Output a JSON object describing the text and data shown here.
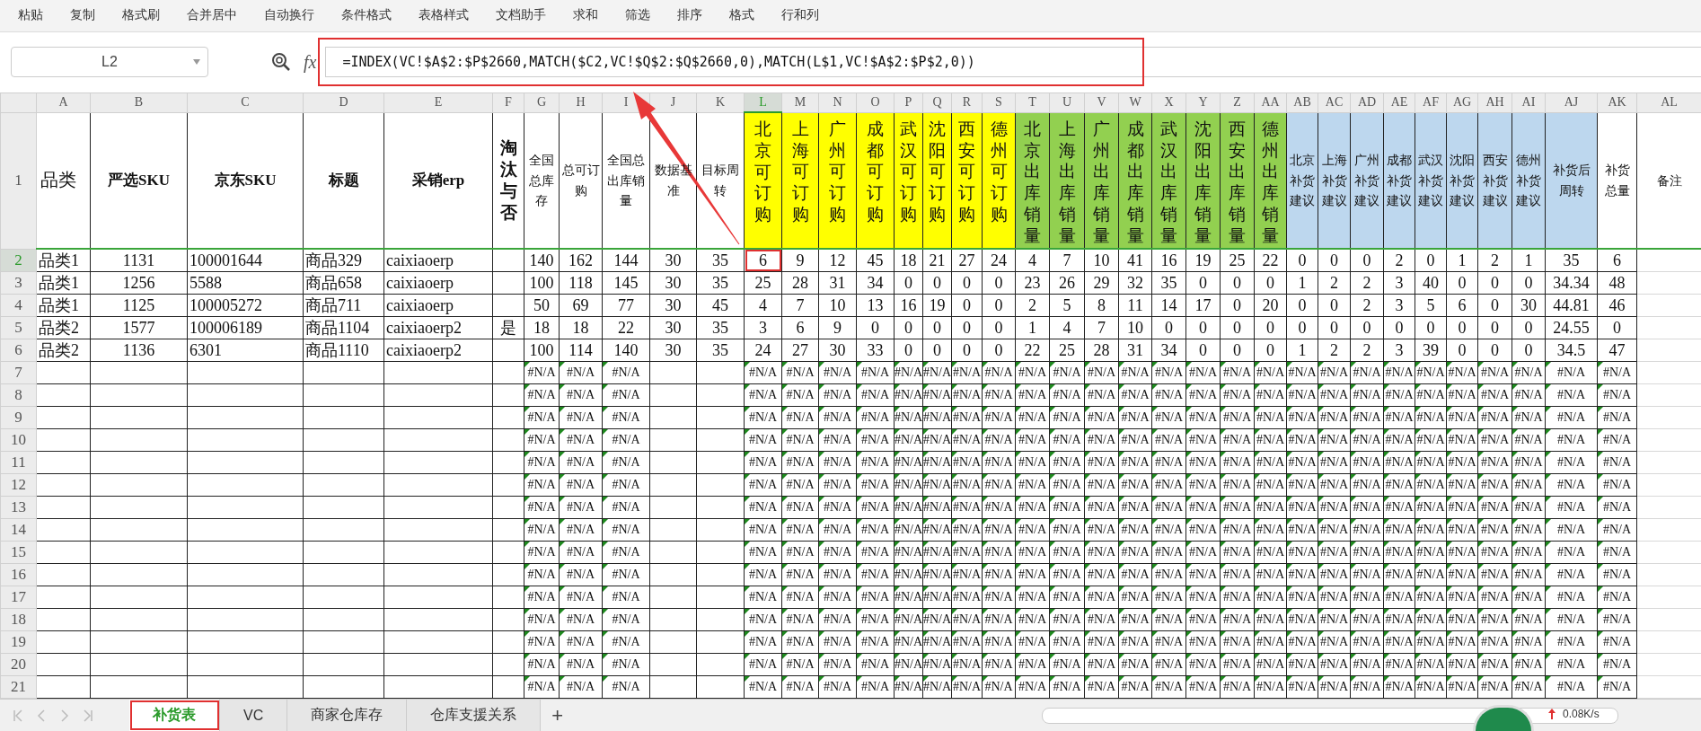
{
  "toolbar": {
    "items": [
      "粘贴",
      "复制",
      "格式刷",
      "合并居中",
      "自动换行",
      "条件格式",
      "表格样式",
      "文档助手",
      "求和",
      "筛选",
      "排序",
      "格式",
      "行和列"
    ]
  },
  "formula_bar": {
    "name_box": "L2",
    "fx": "fx",
    "formula": "=INDEX(VC!$A$2:$P$2660,MATCH($C2,VC!$Q$2:$Q$2660,0),MATCH(L$1,VC!$A$2:$P$2,0))"
  },
  "columns": [
    {
      "letter": "A",
      "selected": false
    },
    {
      "letter": "B",
      "selected": false
    },
    {
      "letter": "C",
      "selected": false
    },
    {
      "letter": "D",
      "selected": false
    },
    {
      "letter": "E",
      "selected": false
    },
    {
      "letter": "F",
      "selected": false
    },
    {
      "letter": "G",
      "selected": false
    },
    {
      "letter": "H",
      "selected": false
    },
    {
      "letter": "I",
      "selected": false
    },
    {
      "letter": "J",
      "selected": false
    },
    {
      "letter": "K",
      "selected": false
    },
    {
      "letter": "L",
      "selected": true
    },
    {
      "letter": "M",
      "selected": false
    },
    {
      "letter": "N",
      "selected": false
    },
    {
      "letter": "O",
      "selected": false
    },
    {
      "letter": "P",
      "selected": false
    },
    {
      "letter": "Q",
      "selected": false
    },
    {
      "letter": "R",
      "selected": false
    },
    {
      "letter": "S",
      "selected": false
    },
    {
      "letter": "T",
      "selected": false
    },
    {
      "letter": "U",
      "selected": false
    },
    {
      "letter": "V",
      "selected": false
    },
    {
      "letter": "W",
      "selected": false
    },
    {
      "letter": "X",
      "selected": false
    },
    {
      "letter": "Y",
      "selected": false
    },
    {
      "letter": "Z",
      "selected": false
    },
    {
      "letter": "AA",
      "selected": false
    },
    {
      "letter": "AB",
      "selected": false
    },
    {
      "letter": "AC",
      "selected": false
    },
    {
      "letter": "AD",
      "selected": false
    },
    {
      "letter": "AE",
      "selected": false
    },
    {
      "letter": "AF",
      "selected": false
    },
    {
      "letter": "AG",
      "selected": false
    },
    {
      "letter": "AH",
      "selected": false
    },
    {
      "letter": "AI",
      "selected": false
    },
    {
      "letter": "AJ",
      "selected": false
    },
    {
      "letter": "AK",
      "selected": false
    },
    {
      "letter": "AL",
      "selected": false
    }
  ],
  "header_row": {
    "number": "1",
    "cells": [
      {
        "text": "品类",
        "kind": "plain"
      },
      {
        "text": "严选SKU",
        "kind": "bold"
      },
      {
        "text": "京东SKU",
        "kind": "bold"
      },
      {
        "text": "标题",
        "kind": "bold"
      },
      {
        "text": "采销erp",
        "kind": "bold"
      },
      {
        "text": "淘汰与否",
        "kind": "vertical-bold"
      },
      {
        "text": "全国总库存",
        "kind": "small"
      },
      {
        "text": "总可订购",
        "kind": "small"
      },
      {
        "text": "全国总出库销量",
        "kind": "small"
      },
      {
        "text": "数据基准",
        "kind": "small"
      },
      {
        "text": "目标周转",
        "kind": "small"
      },
      {
        "text": "北京可订购",
        "kind": "vertical",
        "color": "#ffff00"
      },
      {
        "text": "上海可订购",
        "kind": "vertical",
        "color": "#ffff00"
      },
      {
        "text": "广州可订购",
        "kind": "vertical",
        "color": "#ffff00"
      },
      {
        "text": "成都可订购",
        "kind": "vertical",
        "color": "#ffff00"
      },
      {
        "text": "武汉可订购",
        "kind": "vertical",
        "color": "#ffff00"
      },
      {
        "text": "沈阳可订购",
        "kind": "vertical",
        "color": "#ffff00"
      },
      {
        "text": "西安可订购",
        "kind": "vertical",
        "color": "#ffff00"
      },
      {
        "text": "德州可订购",
        "kind": "vertical",
        "color": "#ffff00"
      },
      {
        "text": "北京出库销量",
        "kind": "vertical",
        "color": "#92d050"
      },
      {
        "text": "上海出库销量",
        "kind": "vertical",
        "color": "#92d050"
      },
      {
        "text": "广州出库销量",
        "kind": "vertical",
        "color": "#92d050"
      },
      {
        "text": "成都出库销量",
        "kind": "vertical",
        "color": "#92d050"
      },
      {
        "text": "武汉出库销量",
        "kind": "vertical",
        "color": "#92d050"
      },
      {
        "text": "沈阳出库销量",
        "kind": "vertical",
        "color": "#92d050"
      },
      {
        "text": "西安出库销量",
        "kind": "vertical",
        "color": "#92d050"
      },
      {
        "text": "德州出库销量",
        "kind": "vertical",
        "color": "#92d050"
      },
      {
        "text": "北京补货建议",
        "kind": "small",
        "color": "#bdd7ee"
      },
      {
        "text": "上海补货建议",
        "kind": "small",
        "color": "#bdd7ee"
      },
      {
        "text": "广州补货建议",
        "kind": "small",
        "color": "#bdd7ee"
      },
      {
        "text": "成都补货建议",
        "kind": "small",
        "color": "#bdd7ee"
      },
      {
        "text": "武汉补货建议",
        "kind": "small",
        "color": "#bdd7ee"
      },
      {
        "text": "沈阳补货建议",
        "kind": "small",
        "color": "#bdd7ee"
      },
      {
        "text": "西安补货建议",
        "kind": "small",
        "color": "#bdd7ee"
      },
      {
        "text": "德州补货建议",
        "kind": "small",
        "color": "#bdd7ee"
      },
      {
        "text": "补货后周转",
        "kind": "small",
        "color": "#bdd7ee"
      },
      {
        "text": "补货总量",
        "kind": "small"
      },
      {
        "text": "备注",
        "kind": "small"
      }
    ]
  },
  "rows": [
    {
      "number": "2",
      "selected": true,
      "kind": "data",
      "category": "品类1",
      "yanxuan_sku": "1131",
      "jd_sku": "100001644",
      "title": "商品329",
      "erp": "caixiaoerp",
      "values": [
        "140",
        "162",
        "144",
        "30",
        "35",
        "6",
        "9",
        "12",
        "45",
        "18",
        "21",
        "27",
        "24",
        "4",
        "7",
        "10",
        "41",
        "16",
        "19",
        "25",
        "22",
        "0",
        "0",
        "0",
        "2",
        "0",
        "1",
        "2",
        "1",
        "35",
        "6"
      ]
    },
    {
      "number": "3",
      "selected": false,
      "kind": "data",
      "category": "品类1",
      "yanxuan_sku": "1256",
      "jd_sku": "5588",
      "title": "商品658",
      "erp": "caixiaoerp",
      "values": [
        "100",
        "118",
        "145",
        "30",
        "35",
        "25",
        "28",
        "31",
        "34",
        "0",
        "0",
        "0",
        "0",
        "23",
        "26",
        "29",
        "32",
        "35",
        "0",
        "0",
        "0",
        "1",
        "2",
        "2",
        "3",
        "40",
        "0",
        "0",
        "0",
        "34.34",
        "48"
      ]
    },
    {
      "number": "4",
      "selected": false,
      "kind": "data",
      "category": "品类1",
      "yanxuan_sku": "1125",
      "jd_sku": "100005272",
      "title": "商品711",
      "erp": "caixiaoerp",
      "values": [
        "50",
        "69",
        "77",
        "30",
        "45",
        "4",
        "7",
        "10",
        "13",
        "16",
        "19",
        "0",
        "0",
        "2",
        "5",
        "8",
        "11",
        "14",
        "17",
        "0",
        "20",
        "0",
        "0",
        "2",
        "3",
        "5",
        "6",
        "0",
        "30",
        "44.81",
        "46"
      ]
    },
    {
      "number": "5",
      "selected": false,
      "kind": "data",
      "category": "品类2",
      "yanxuan_sku": "1577",
      "jd_sku": "100006189",
      "title": "商品1104",
      "erp": "caixiaoerp2",
      "eliminated": "是",
      "values": [
        "18",
        "18",
        "22",
        "30",
        "35",
        "3",
        "6",
        "9",
        "0",
        "0",
        "0",
        "0",
        "0",
        "1",
        "4",
        "7",
        "10",
        "0",
        "0",
        "0",
        "0",
        "0",
        "0",
        "0",
        "0",
        "0",
        "0",
        "0",
        "0",
        "24.55",
        "0"
      ]
    },
    {
      "number": "6",
      "selected": false,
      "kind": "data",
      "category": "品类2",
      "yanxuan_sku": "1136",
      "jd_sku": "6301",
      "title": "商品1110",
      "erp": "caixiaoerp2",
      "values": [
        "100",
        "114",
        "140",
        "30",
        "35",
        "24",
        "27",
        "30",
        "33",
        "0",
        "0",
        "0",
        "0",
        "22",
        "25",
        "28",
        "31",
        "34",
        "0",
        "0",
        "0",
        "1",
        "2",
        "2",
        "3",
        "39",
        "0",
        "0",
        "0",
        "34.5",
        "47"
      ]
    },
    {
      "number": "7",
      "selected": false,
      "kind": "error",
      "values": [
        "#N/A",
        "#N/A",
        "#N/A",
        "#N/A",
        "#N/A",
        "#N/A",
        "#N/A",
        "#N/A",
        "#N/A",
        "#N/A",
        "#N/A",
        "#N/A",
        "#N/A",
        "#N/A",
        "#N/A",
        "#N/A",
        "#N/A",
        "#N/A",
        "#N/A",
        "#N/A",
        "#N/A",
        "#N/A",
        "#N/A",
        "#N/A",
        "#N/A",
        "#N/A",
        "#N/A",
        "#N/A",
        "#N/A"
      ]
    },
    {
      "number": "8",
      "selected": false,
      "kind": "error",
      "values": [
        "#N/A",
        "#N/A",
        "#N/A",
        "#N/A",
        "#N/A",
        "#N/A",
        "#N/A",
        "#N/A",
        "#N/A",
        "#N/A",
        "#N/A",
        "#N/A",
        "#N/A",
        "#N/A",
        "#N/A",
        "#N/A",
        "#N/A",
        "#N/A",
        "#N/A",
        "#N/A",
        "#N/A",
        "#N/A",
        "#N/A",
        "#N/A",
        "#N/A",
        "#N/A",
        "#N/A",
        "#N/A",
        "#N/A"
      ]
    },
    {
      "number": "9",
      "selected": false,
      "kind": "error",
      "values": [
        "#N/A",
        "#N/A",
        "#N/A",
        "#N/A",
        "#N/A",
        "#N/A",
        "#N/A",
        "#N/A",
        "#N/A",
        "#N/A",
        "#N/A",
        "#N/A",
        "#N/A",
        "#N/A",
        "#N/A",
        "#N/A",
        "#N/A",
        "#N/A",
        "#N/A",
        "#N/A",
        "#N/A",
        "#N/A",
        "#N/A",
        "#N/A",
        "#N/A",
        "#N/A",
        "#N/A",
        "#N/A",
        "#N/A"
      ]
    },
    {
      "number": "10",
      "selected": false,
      "kind": "error",
      "values": [
        "#N/A",
        "#N/A",
        "#N/A",
        "#N/A",
        "#N/A",
        "#N/A",
        "#N/A",
        "#N/A",
        "#N/A",
        "#N/A",
        "#N/A",
        "#N/A",
        "#N/A",
        "#N/A",
        "#N/A",
        "#N/A",
        "#N/A",
        "#N/A",
        "#N/A",
        "#N/A",
        "#N/A",
        "#N/A",
        "#N/A",
        "#N/A",
        "#N/A",
        "#N/A",
        "#N/A",
        "#N/A",
        "#N/A"
      ]
    },
    {
      "number": "11",
      "selected": false,
      "kind": "error",
      "values": [
        "#N/A",
        "#N/A",
        "#N/A",
        "#N/A",
        "#N/A",
        "#N/A",
        "#N/A",
        "#N/A",
        "#N/A",
        "#N/A",
        "#N/A",
        "#N/A",
        "#N/A",
        "#N/A",
        "#N/A",
        "#N/A",
        "#N/A",
        "#N/A",
        "#N/A",
        "#N/A",
        "#N/A",
        "#N/A",
        "#N/A",
        "#N/A",
        "#N/A",
        "#N/A",
        "#N/A",
        "#N/A",
        "#N/A"
      ]
    },
    {
      "number": "12",
      "selected": false,
      "kind": "error",
      "values": [
        "#N/A",
        "#N/A",
        "#N/A",
        "#N/A",
        "#N/A",
        "#N/A",
        "#N/A",
        "#N/A",
        "#N/A",
        "#N/A",
        "#N/A",
        "#N/A",
        "#N/A",
        "#N/A",
        "#N/A",
        "#N/A",
        "#N/A",
        "#N/A",
        "#N/A",
        "#N/A",
        "#N/A",
        "#N/A",
        "#N/A",
        "#N/A",
        "#N/A",
        "#N/A",
        "#N/A",
        "#N/A",
        "#N/A"
      ]
    },
    {
      "number": "13",
      "selected": false,
      "kind": "error",
      "values": [
        "#N/A",
        "#N/A",
        "#N/A",
        "#N/A",
        "#N/A",
        "#N/A",
        "#N/A",
        "#N/A",
        "#N/A",
        "#N/A",
        "#N/A",
        "#N/A",
        "#N/A",
        "#N/A",
        "#N/A",
        "#N/A",
        "#N/A",
        "#N/A",
        "#N/A",
        "#N/A",
        "#N/A",
        "#N/A",
        "#N/A",
        "#N/A",
        "#N/A",
        "#N/A",
        "#N/A",
        "#N/A",
        "#N/A"
      ]
    },
    {
      "number": "14",
      "selected": false,
      "kind": "error",
      "values": [
        "#N/A",
        "#N/A",
        "#N/A",
        "#N/A",
        "#N/A",
        "#N/A",
        "#N/A",
        "#N/A",
        "#N/A",
        "#N/A",
        "#N/A",
        "#N/A",
        "#N/A",
        "#N/A",
        "#N/A",
        "#N/A",
        "#N/A",
        "#N/A",
        "#N/A",
        "#N/A",
        "#N/A",
        "#N/A",
        "#N/A",
        "#N/A",
        "#N/A",
        "#N/A",
        "#N/A",
        "#N/A",
        "#N/A"
      ]
    },
    {
      "number": "15",
      "selected": false,
      "kind": "error",
      "values": [
        "#N/A",
        "#N/A",
        "#N/A",
        "#N/A",
        "#N/A",
        "#N/A",
        "#N/A",
        "#N/A",
        "#N/A",
        "#N/A",
        "#N/A",
        "#N/A",
        "#N/A",
        "#N/A",
        "#N/A",
        "#N/A",
        "#N/A",
        "#N/A",
        "#N/A",
        "#N/A",
        "#N/A",
        "#N/A",
        "#N/A",
        "#N/A",
        "#N/A",
        "#N/A",
        "#N/A",
        "#N/A",
        "#N/A"
      ]
    },
    {
      "number": "16",
      "selected": false,
      "kind": "error",
      "values": [
        "#N/A",
        "#N/A",
        "#N/A",
        "#N/A",
        "#N/A",
        "#N/A",
        "#N/A",
        "#N/A",
        "#N/A",
        "#N/A",
        "#N/A",
        "#N/A",
        "#N/A",
        "#N/A",
        "#N/A",
        "#N/A",
        "#N/A",
        "#N/A",
        "#N/A",
        "#N/A",
        "#N/A",
        "#N/A",
        "#N/A",
        "#N/A",
        "#N/A",
        "#N/A",
        "#N/A",
        "#N/A",
        "#N/A"
      ]
    },
    {
      "number": "17",
      "selected": false,
      "kind": "error",
      "values": [
        "#N/A",
        "#N/A",
        "#N/A",
        "#N/A",
        "#N/A",
        "#N/A",
        "#N/A",
        "#N/A",
        "#N/A",
        "#N/A",
        "#N/A",
        "#N/A",
        "#N/A",
        "#N/A",
        "#N/A",
        "#N/A",
        "#N/A",
        "#N/A",
        "#N/A",
        "#N/A",
        "#N/A",
        "#N/A",
        "#N/A",
        "#N/A",
        "#N/A",
        "#N/A",
        "#N/A",
        "#N/A",
        "#N/A"
      ]
    },
    {
      "number": "18",
      "selected": false,
      "kind": "error",
      "values": [
        "#N/A",
        "#N/A",
        "#N/A",
        "#N/A",
        "#N/A",
        "#N/A",
        "#N/A",
        "#N/A",
        "#N/A",
        "#N/A",
        "#N/A",
        "#N/A",
        "#N/A",
        "#N/A",
        "#N/A",
        "#N/A",
        "#N/A",
        "#N/A",
        "#N/A",
        "#N/A",
        "#N/A",
        "#N/A",
        "#N/A",
        "#N/A",
        "#N/A",
        "#N/A",
        "#N/A",
        "#N/A",
        "#N/A"
      ]
    },
    {
      "number": "19",
      "selected": false,
      "kind": "error",
      "values": [
        "#N/A",
        "#N/A",
        "#N/A",
        "#N/A",
        "#N/A",
        "#N/A",
        "#N/A",
        "#N/A",
        "#N/A",
        "#N/A",
        "#N/A",
        "#N/A",
        "#N/A",
        "#N/A",
        "#N/A",
        "#N/A",
        "#N/A",
        "#N/A",
        "#N/A",
        "#N/A",
        "#N/A",
        "#N/A",
        "#N/A",
        "#N/A",
        "#N/A",
        "#N/A",
        "#N/A",
        "#N/A",
        "#N/A"
      ]
    },
    {
      "number": "20",
      "selected": false,
      "kind": "error",
      "values": [
        "#N/A",
        "#N/A",
        "#N/A",
        "#N/A",
        "#N/A",
        "#N/A",
        "#N/A",
        "#N/A",
        "#N/A",
        "#N/A",
        "#N/A",
        "#N/A",
        "#N/A",
        "#N/A",
        "#N/A",
        "#N/A",
        "#N/A",
        "#N/A",
        "#N/A",
        "#N/A",
        "#N/A",
        "#N/A",
        "#N/A",
        "#N/A",
        "#N/A",
        "#N/A",
        "#N/A",
        "#N/A",
        "#N/A"
      ]
    },
    {
      "number": "21",
      "selected": false,
      "kind": "error",
      "values": [
        "#N/A",
        "#N/A",
        "#N/A",
        "#N/A",
        "#N/A",
        "#N/A",
        "#N/A",
        "#N/A",
        "#N/A",
        "#N/A",
        "#N/A",
        "#N/A",
        "#N/A",
        "#N/A",
        "#N/A",
        "#N/A",
        "#N/A",
        "#N/A",
        "#N/A",
        "#N/A",
        "#N/A",
        "#N/A",
        "#N/A",
        "#N/A",
        "#N/A",
        "#N/A",
        "#N/A",
        "#N/A",
        "#N/A"
      ]
    }
  ],
  "sheet_tabs": [
    {
      "label": "补货表",
      "selected": true
    },
    {
      "label": "VC",
      "selected": false
    },
    {
      "label": "商家仓库存",
      "selected": false
    },
    {
      "label": "仓库支援关系",
      "selected": false
    }
  ],
  "add_sheet": "+",
  "network_speed": "0.08K/s"
}
